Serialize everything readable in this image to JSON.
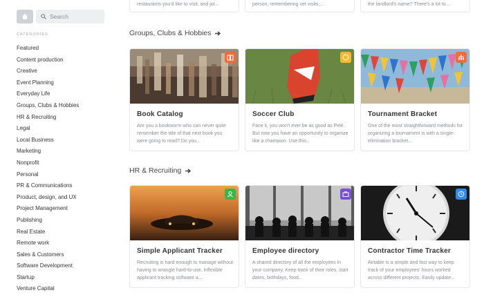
{
  "search": {
    "placeholder": "Search"
  },
  "sidebar": {
    "heading": "CATEGORIES",
    "items": [
      "Featured",
      "Content production",
      "Creative",
      "Event Planning",
      "Everyday Life",
      "Groups, Clubs & Hobbies",
      "HR & Recruiting",
      "Legal",
      "Local Business",
      "Marketing",
      "Nonprofit",
      "Personal",
      "PR & Communications",
      "Product, design, and UX",
      "Project Management",
      "Publishing",
      "Real Estate",
      "Remote work",
      "Sales & Customers",
      "Software Development",
      "Startup",
      "Venture Capital"
    ]
  },
  "top_cards": [
    {
      "desc": "restaurants you'd like to visit, and jot..."
    },
    {
      "desc": "person, remembering vet visits,..."
    },
    {
      "desc": "the landlord's name? There's a lot to..."
    }
  ],
  "sections": [
    {
      "title": "Groups, Clubs & Hobbies",
      "cards": [
        {
          "title": "Book Catalog",
          "desc": "Are you a bookworm who can never quite remember the title of that next book you were going to read? Do you...",
          "badge_color": "#f26b3a",
          "icon": "book-icon"
        },
        {
          "title": "Soccer Club",
          "desc": "Face it, you won't ever be as good as Pelé. But now you have an opportunity to organize like a champion. Use this...",
          "badge_color": "#f5b93a",
          "icon": "ball-icon"
        },
        {
          "title": "Tournament Bracket",
          "desc": "One of the most straightforward methods for organizing a tournament is with a single-elimination bracket...",
          "badge_color": "#f26b3a",
          "icon": "bracket-icon"
        }
      ]
    },
    {
      "title": "HR & Recruiting",
      "cards": [
        {
          "title": "Simple Applicant Tracker",
          "desc": "Recruiting is hard enough to manage without having to wrangle hard-to-use, inflexible applicant tracking software a...",
          "badge_color": "#3cb44b",
          "icon": "person-icon"
        },
        {
          "title": "Employee directory",
          "desc": "A shared directory of all the employees in your company. Keep track of their roles, start dates, birthdays, food...",
          "badge_color": "#7b4fd1",
          "icon": "briefcase-icon"
        },
        {
          "title": "Contractor Time Tracker",
          "desc": "Airtable is a simple and fast way to keep track of your employees' hours worked across different projects. Easily update...",
          "badge_color": "#2d8cf0",
          "icon": "clock-icon"
        }
      ]
    }
  ]
}
